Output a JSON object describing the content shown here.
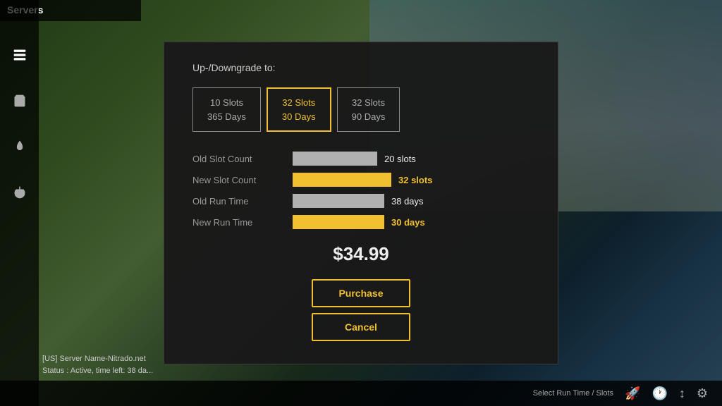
{
  "sidebar": {
    "header": "Servers",
    "icons": [
      {
        "name": "servers-icon",
        "symbol": "⊞"
      },
      {
        "name": "cart-icon",
        "symbol": "🛒"
      },
      {
        "name": "rocket-icon",
        "symbol": "🚀"
      },
      {
        "name": "power-icon",
        "symbol": "⏻"
      }
    ]
  },
  "server": {
    "name": "[US] Server Name-Nitrado.net",
    "status": "Status : Active, time left: 38 da..."
  },
  "bottomBar": {
    "items": [
      {
        "name": "rocket-bottom-icon",
        "symbol": "🚀"
      },
      {
        "name": "clock-bottom-icon",
        "symbol": "🕐"
      },
      {
        "name": "arrows-bottom-icon",
        "symbol": "↕"
      },
      {
        "name": "gear-bottom-icon",
        "symbol": "⚙"
      }
    ],
    "text": "Select Run Time / Slots"
  },
  "modal": {
    "title": "Up-/Downgrade to:",
    "slotOptions": [
      {
        "label": "10 Slots\n365 Days",
        "active": false
      },
      {
        "label": "32 Slots\n30 Days",
        "active": true
      },
      {
        "label": "32 Slots\n90 Days",
        "active": false
      }
    ],
    "rows": [
      {
        "label": "Old Slot Count",
        "barType": "gray",
        "value": "20 slots",
        "valueColor": "normal"
      },
      {
        "label": "New Slot Count",
        "barType": "yellow",
        "value": "32 slots",
        "valueColor": "yellow"
      },
      {
        "label": "Old Run Time",
        "barType": "gray-days",
        "value": "38 days",
        "valueColor": "normal"
      },
      {
        "label": "New Run Time",
        "barType": "yellow-days",
        "value": "30 days",
        "valueColor": "yellow"
      }
    ],
    "price": "$34.99",
    "purchaseLabel": "Purchase",
    "cancelLabel": "Cancel"
  }
}
